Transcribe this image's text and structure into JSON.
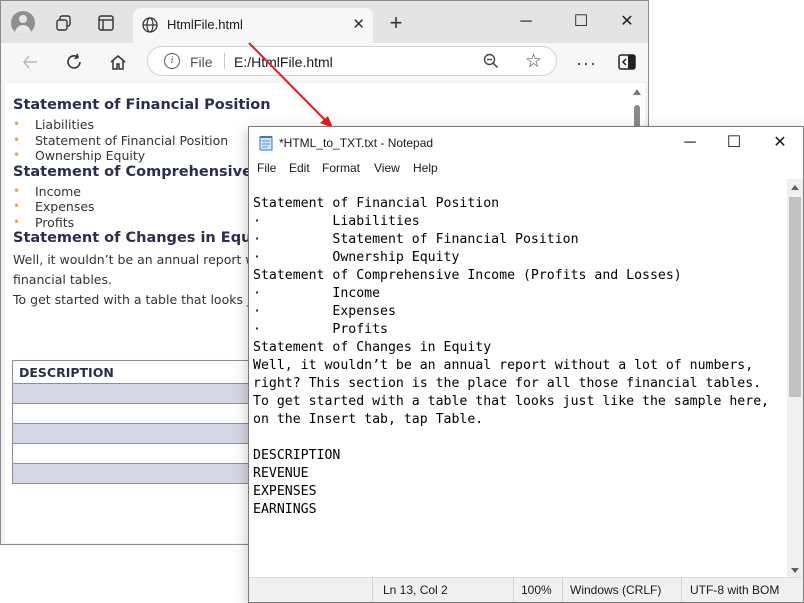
{
  "browser": {
    "tab_title": "HtmlFile.html",
    "address_scheme": "File",
    "address_url": "E:/HtmlFile.html"
  },
  "webpage": {
    "section1": {
      "heading": "Statement of Financial Position",
      "items": [
        "Liabilities",
        "Statement of Financial Position",
        "Ownership Equity"
      ]
    },
    "section2": {
      "heading": "Statement of Comprehensive Inc",
      "items": [
        "Income",
        "Expenses",
        "Profits"
      ]
    },
    "section3": {
      "heading": "Statement of Changes in Equity",
      "para1_line1": "Well, it wouldn’t be an annual report withou",
      "para1_line2": "financial tables.",
      "para2": "To get started with a table that looks just li"
    },
    "table": {
      "header": "DESCRIPTION"
    }
  },
  "notepad": {
    "title": "*HTML_to_TXT.txt - Notepad",
    "menu": [
      "File",
      "Edit",
      "Format",
      "View",
      "Help"
    ],
    "lines": [
      "Statement of Financial Position",
      "·         Liabilities",
      "·         Statement of Financial Position",
      "·         Ownership Equity",
      "Statement of Comprehensive Income (Profits and Losses)",
      "·         Income",
      "·         Expenses",
      "·         Profits",
      "Statement of Changes in Equity",
      "Well, it wouldn’t be an annual report without a lot of numbers,",
      "right? This section is the place for all those financial tables.",
      "To get started with a table that looks just like the sample here,",
      "on the Insert tab, tap Table.",
      "",
      "DESCRIPTION",
      "REVENUE",
      "EXPENSES",
      "EARNINGS"
    ],
    "status": {
      "position": "Ln 13, Col 2",
      "zoom": "100%",
      "line_ending": "Windows (CRLF)",
      "encoding": "UTF-8 with BOM"
    }
  },
  "colors": {
    "arrow": "#e02020",
    "bullet": "#e2b13c",
    "table_shade": "#d6d7e6"
  }
}
